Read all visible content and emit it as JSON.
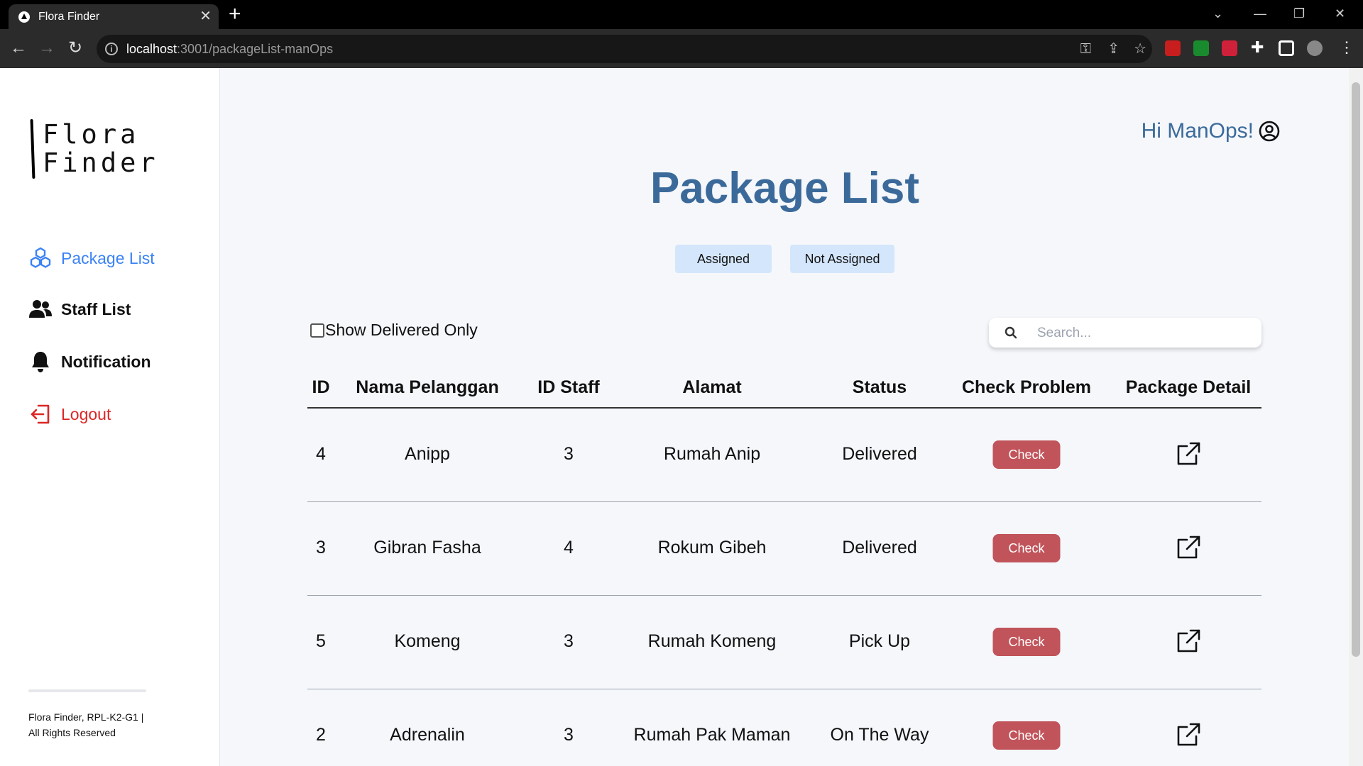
{
  "browser": {
    "tab_title": "Flora Finder",
    "url_host": "localhost",
    "url_path": ":3001/packageList-manOps"
  },
  "sidebar": {
    "logo_line1": "Flora",
    "logo_line2": "Finder",
    "items": [
      {
        "label": "Package List",
        "icon": "cubes-icon"
      },
      {
        "label": "Staff List",
        "icon": "users-icon"
      },
      {
        "label": "Notification",
        "icon": "bell-icon"
      },
      {
        "label": "Logout",
        "icon": "logout-icon"
      }
    ],
    "footer_line1": "Flora Finder, RPL-K2-G1 |",
    "footer_line2": "All Rights Reserved"
  },
  "header": {
    "greeting": "Hi ManOps!"
  },
  "main": {
    "title": "Package List",
    "filter_assigned": "Assigned",
    "filter_not_assigned": "Not Assigned",
    "show_delivered_label": "Show Delivered Only",
    "show_delivered_checked": false,
    "search_placeholder": "Search..."
  },
  "table": {
    "columns": [
      "ID",
      "Nama Pelanggan",
      "ID Staff",
      "Alamat",
      "Status",
      "Check Problem",
      "Package Detail"
    ],
    "rows": [
      {
        "id": "4",
        "nama": "Anipp",
        "id_staff": "3",
        "alamat": "Rumah Anip",
        "status": "Delivered",
        "check_label": "Check"
      },
      {
        "id": "3",
        "nama": "Gibran Fasha",
        "id_staff": "4",
        "alamat": "Rokum Gibeh",
        "status": "Delivered",
        "check_label": "Check"
      },
      {
        "id": "5",
        "nama": "Komeng",
        "id_staff": "3",
        "alamat": "Rumah Komeng",
        "status": "Pick Up",
        "check_label": "Check"
      },
      {
        "id": "2",
        "nama": "Adrenalin",
        "id_staff": "3",
        "alamat": "Rumah Pak Maman",
        "status": "On The Way",
        "check_label": "Check"
      }
    ]
  },
  "colors": {
    "accent_blue": "#3b6a9a",
    "active_nav": "#3b82f6",
    "logout_red": "#dc2626",
    "check_button": "#c0545a",
    "filter_button_bg": "#d4e6fb"
  }
}
